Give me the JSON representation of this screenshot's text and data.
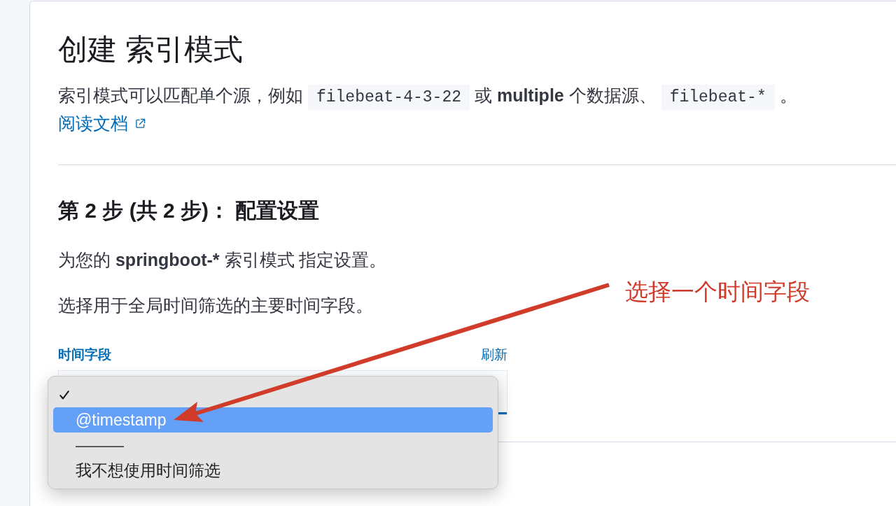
{
  "page": {
    "title": "创建 索引模式",
    "description": [
      {
        "kind": "text",
        "text": "索引模式可以匹配单个源，例如"
      },
      {
        "kind": "code",
        "text": "filebeat-4-3-22"
      },
      {
        "kind": "text",
        "text": "或"
      },
      {
        "kind": "strong",
        "text": "multiple"
      },
      {
        "kind": "text",
        "text": "个数据源、"
      },
      {
        "kind": "code",
        "text": "filebeat-*"
      },
      {
        "kind": "text",
        "text": "。"
      }
    ],
    "docs_link": "阅读文档"
  },
  "step": {
    "title": "第 2 步 (共 2 步)： 配置设置",
    "intro": [
      {
        "kind": "text",
        "text": "为您的"
      },
      {
        "kind": "strong",
        "text": "springboot-*"
      },
      {
        "kind": "text",
        "text": "索引模式 指定设置。"
      }
    ],
    "hint": "选择用于全局时间筛选的主要时间字段。"
  },
  "time_field": {
    "label": "时间字段",
    "refresh": "刷新",
    "focused": true,
    "options": [
      {
        "kind": "option",
        "checked": true,
        "selected": false
      },
      {
        "kind": "option",
        "label": "@timestamp",
        "checked": false,
        "selected": true
      },
      {
        "kind": "separator",
        "label": "———",
        "checked": false,
        "selected": false
      },
      {
        "kind": "option",
        "label": "我不想使用时间筛选",
        "checked": false,
        "selected": false
      }
    ]
  },
  "annotation": {
    "text": "选择一个时间字段"
  }
}
